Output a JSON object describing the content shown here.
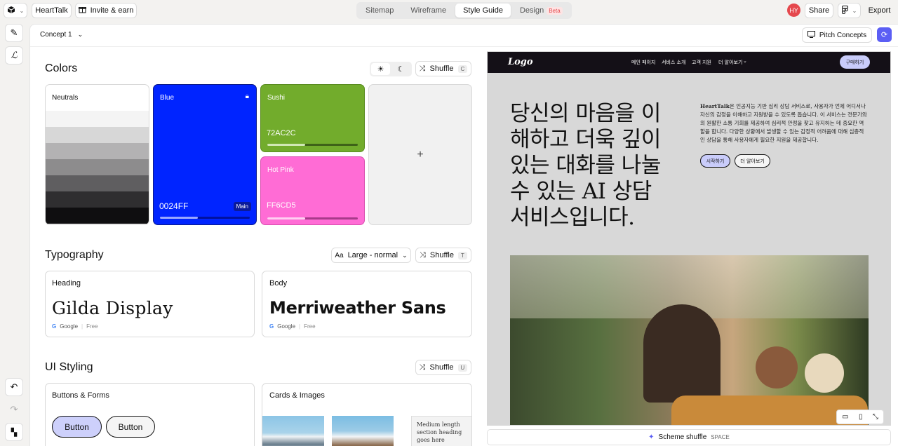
{
  "topbar": {
    "project": "HeartTalk",
    "invite": "Invite & earn",
    "tabs": [
      {
        "label": "Sitemap"
      },
      {
        "label": "Wireframe"
      },
      {
        "label": "Style Guide"
      },
      {
        "label": "Design"
      }
    ],
    "beta": "Beta",
    "avatar": "HY",
    "share": "Share",
    "export": "Export"
  },
  "subheader": {
    "concept": "Concept 1",
    "pitch": "Pitch Concepts"
  },
  "colors": {
    "title": "Colors",
    "shuffle": "Shuffle",
    "shortcut": "C",
    "neutrals": {
      "name": "Neutrals",
      "shades": [
        "#f4f4f4",
        "#d7d7d7",
        "#b3b2b3",
        "#8d8c8d",
        "#5f5e60",
        "#2f2e30",
        "#0f0e10"
      ]
    },
    "blue": {
      "name": "Blue",
      "hex": "0024FF",
      "badge": "Main",
      "color": "#0024ff"
    },
    "sushi": {
      "name": "Sushi",
      "hex": "72AC2C",
      "color": "#72ac2c"
    },
    "hotpink": {
      "name": "Hot Pink",
      "hex": "FF6CD5",
      "color": "#ff6cd5"
    },
    "add": "+"
  },
  "typography": {
    "title": "Typography",
    "size": "Large - normal",
    "shuffle": "Shuffle",
    "shortcut": "T",
    "heading": {
      "label": "Heading",
      "font": "Gilda Display",
      "source": "Google",
      "price": "Free"
    },
    "body": {
      "label": "Body",
      "font": "Merriweather Sans",
      "source": "Google",
      "price": "Free"
    }
  },
  "ui": {
    "title": "UI Styling",
    "shuffle": "Shuffle",
    "shortcut": "U",
    "buttons_label": "Buttons & Forms",
    "button1": "Button",
    "button2": "Button",
    "cards_label": "Cards & Images",
    "card_text": "Medium length section heading goes here"
  },
  "preview": {
    "logo": "Logo",
    "nav": [
      "메인 페이지",
      "서비스 소개",
      "고객 지원",
      "더 알아보기"
    ],
    "cta": "구매하기",
    "headline_lines": [
      "당신의 마음을 이",
      "해하고 더욱 깊이",
      "있는 대화를 나눌",
      "수 있는 AI 상담",
      "서비스입니다."
    ],
    "brand": "HeartTalk",
    "desc": "은 인공지능 기반 심리 상담 서비스로, 사용자가 언제 어디서나 자신의 감정을 이해하고 지원받을 수 있도록 돕습니다. 이 서비스는 전문가와의 원활한 소통 기회를 제공하여 심리적 안정을 찾고 유지하는 데 중요한 역할을 합니다. 다양한 상황에서 발생할 수 있는 감정적 어려움에 대해 심층적인 상담을 통해 사용자에게 필요한 지원을 제공합니다.",
    "btn_start": "시작하기",
    "btn_more": "더 알아보기"
  },
  "bottom": {
    "scheme": "Scheme shuffle",
    "key": "SPACE"
  }
}
